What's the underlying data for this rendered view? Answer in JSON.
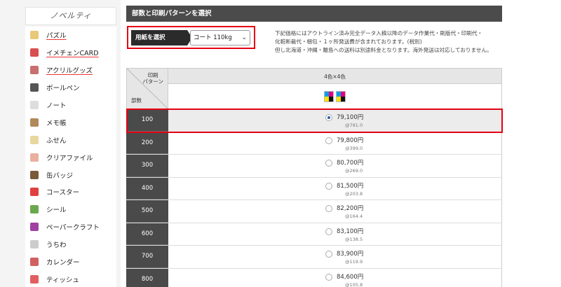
{
  "sidebar": {
    "header": "ノベルティ",
    "items": [
      {
        "label": "パズル",
        "icon": "puzzle-icon",
        "underline": true,
        "color": "#e8c97a"
      },
      {
        "label": "イメチェンCARD",
        "icon": "card-icon",
        "underline": true,
        "color": "#d94f4f"
      },
      {
        "label": "アクリルグッズ",
        "icon": "acrylic-icon",
        "underline": true,
        "color": "#c87070"
      },
      {
        "label": "ボールペン",
        "icon": "pen-icon",
        "underline": false,
        "color": "#555555"
      },
      {
        "label": "ノート",
        "icon": "notebook-icon",
        "underline": false,
        "color": "#dddddd"
      },
      {
        "label": "メモ帳",
        "icon": "memo-icon",
        "underline": false,
        "color": "#b08a5a"
      },
      {
        "label": "ふせん",
        "icon": "sticky-note-icon",
        "underline": false,
        "color": "#e8d8a0"
      },
      {
        "label": "クリアファイル",
        "icon": "clear-file-icon",
        "underline": false,
        "color": "#e9b0a0"
      },
      {
        "label": "缶バッジ",
        "icon": "badge-icon",
        "underline": false,
        "color": "#7a5a3a"
      },
      {
        "label": "コースター",
        "icon": "coaster-icon",
        "underline": false,
        "color": "#e04040"
      },
      {
        "label": "シール",
        "icon": "sticker-icon",
        "underline": false,
        "color": "#6aa84f"
      },
      {
        "label": "ペーパークラフト",
        "icon": "papercraft-icon",
        "underline": false,
        "color": "#a040a0"
      },
      {
        "label": "うちわ",
        "icon": "fan-icon",
        "underline": false,
        "color": "#cccccc"
      },
      {
        "label": "カレンダー",
        "icon": "calendar-icon",
        "underline": false,
        "color": "#d06060"
      },
      {
        "label": "ティッシュ",
        "icon": "tissue-icon",
        "underline": false,
        "color": "#e06060"
      }
    ]
  },
  "main": {
    "title": "部数と印刷パターンを選択",
    "paper_label": "用紙を選択",
    "paper_value": "コート 110kg",
    "notice_lines": [
      "下記価格にはアウトライン済み完全データ入稿以降のデータ作業代・刷版代・印刷代・",
      "化粧断裁代・梱包・１ヶ所発送費が含まれております。(税別)",
      "但し北海道・沖縄・離島への送料は別途料金となります。海外発送は対応しておりません。"
    ]
  },
  "table": {
    "corner_top": "印刷\nパターン",
    "corner_bottom": "部数",
    "column_header": "4色×4色",
    "selected_index": 0,
    "rows": [
      {
        "qty": "100",
        "price": "79,100円",
        "unit": "@791.0"
      },
      {
        "qty": "200",
        "price": "79,800円",
        "unit": "@399.0"
      },
      {
        "qty": "300",
        "price": "80,700円",
        "unit": "@269.0"
      },
      {
        "qty": "400",
        "price": "81,500円",
        "unit": "@203.8"
      },
      {
        "qty": "500",
        "price": "82,200円",
        "unit": "@164.4"
      },
      {
        "qty": "600",
        "price": "83,100円",
        "unit": "@138.5"
      },
      {
        "qty": "700",
        "price": "83,900円",
        "unit": "@119.9"
      },
      {
        "qty": "800",
        "price": "84,600円",
        "unit": "@105.8"
      }
    ]
  },
  "colors": {
    "accent_red": "#e60012",
    "header_dark": "#4b4b4b",
    "radio_selected": "#2a5da8"
  }
}
